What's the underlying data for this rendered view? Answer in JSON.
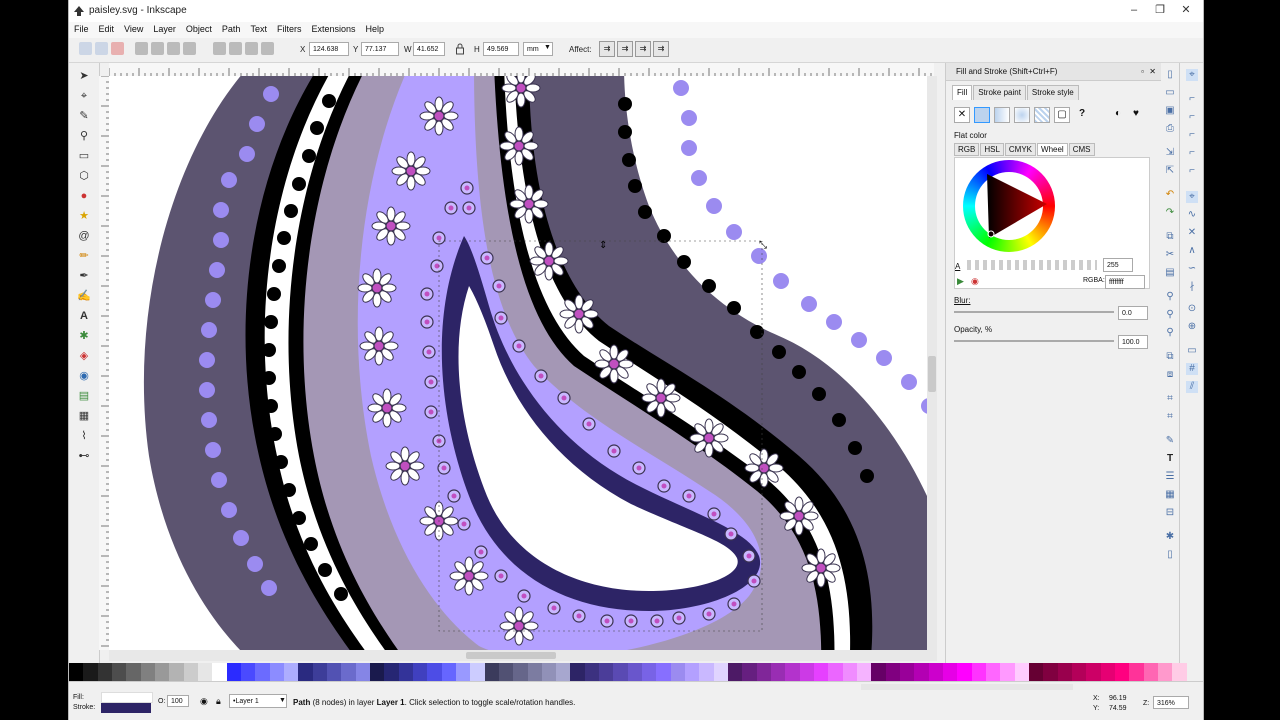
{
  "window": {
    "title": "paisley.svg - Inkscape",
    "controls": [
      "–",
      "❐",
      "✕"
    ]
  },
  "menu": [
    "File",
    "Edit",
    "View",
    "Layer",
    "Object",
    "Path",
    "Text",
    "Filters",
    "Extensions",
    "Help"
  ],
  "toolcontrols": {
    "x_label": "X",
    "x_value": "124.638",
    "y_label": "Y",
    "y_value": "77.137",
    "w_label": "W",
    "w_value": "41.652",
    "h_label": "H",
    "h_value": "49.569",
    "unit": "mm",
    "affect_label": "Affect:"
  },
  "tools": [
    "selector-tool",
    "node-tool",
    "tweak-tool",
    "zoom-tool",
    "rect-tool",
    "3dbox-tool",
    "ellipse-tool",
    "star-tool",
    "spiral-tool",
    "pencil-tool",
    "pen-tool",
    "calligraphy-tool",
    "text-tool",
    "spray-tool",
    "eraser-tool",
    "bucket-tool",
    "gradient-tool",
    "mesh-tool",
    "dropper-tool",
    "connector-tool"
  ],
  "fill_stroke": {
    "title": "Fill and Stroke (Shift+Ctrl+F)",
    "tabs": [
      "Fill",
      "Stroke paint",
      "Stroke style"
    ],
    "flat_color_label": "Flat color",
    "modes": [
      "RGB",
      "HSL",
      "CMYK",
      "Wheel",
      "CMS"
    ],
    "active_mode": "Wheel",
    "alpha_label": "A",
    "alpha_value": "255",
    "rgba_label": "RGBA:",
    "rgba_value": "ffffffff",
    "blur_label": "Blur:",
    "blur_value": "0.0",
    "opacity_label": "Opacity, %",
    "opacity_value": "100.0"
  },
  "status": {
    "fill_label": "Fill:",
    "stroke_label": "Stroke:",
    "stroke_color": "#2d2466",
    "opacity_label": "O:",
    "opacity_value": "100",
    "layer": "•Layer 1",
    "message_bold": "Path",
    "message": " (8 nodes) in layer ",
    "message_layer": "Layer 1",
    "message_tail": ". Click selection to toggle scale/rotation handles.",
    "x_label": "X:",
    "x_value": "96.19",
    "y_label": "Y:",
    "y_value": "74.59",
    "zoom_label": "Z:",
    "zoom_value": "316%"
  },
  "colors": {
    "accent": "#3399ff",
    "dark_band": "#5c5470",
    "mauve": "#a497b5",
    "lavender": "#b3a0ff",
    "deep_purple": "#2d2466",
    "dot": "#9b8bf0"
  }
}
